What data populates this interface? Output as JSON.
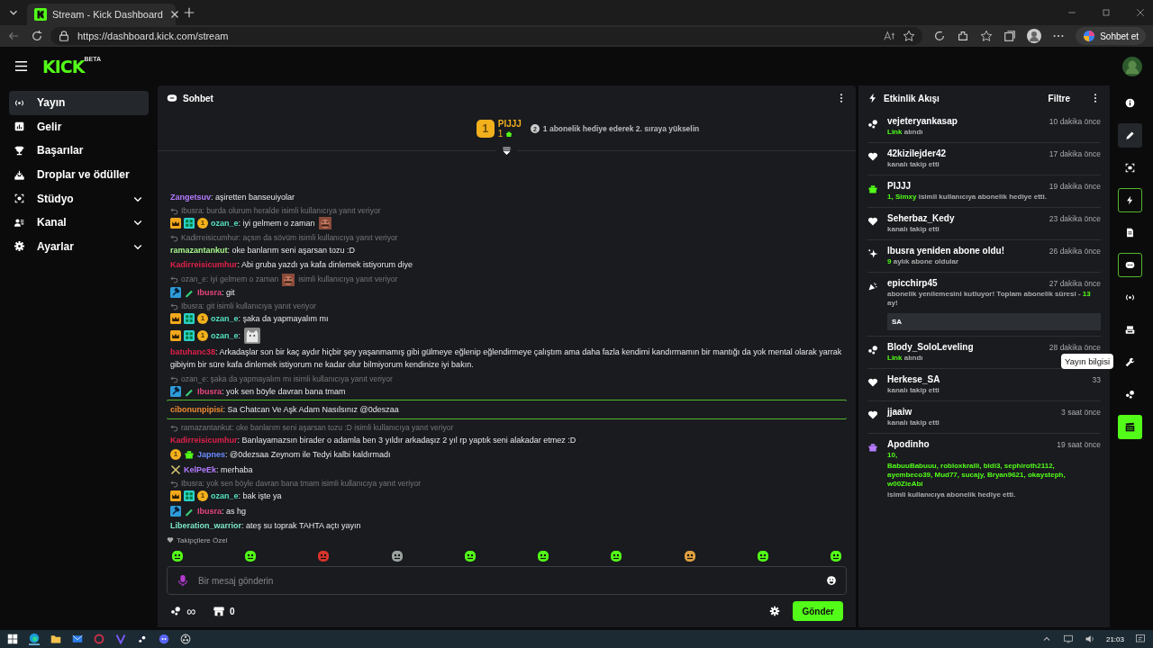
{
  "browser": {
    "tab_title": "Stream - Kick Dashboard",
    "url": "https://dashboard.kick.com/stream",
    "copilot_label": "Sohbet et"
  },
  "header": {
    "logo": "KICK",
    "logo_badge": "BETA"
  },
  "sidebar": {
    "items": [
      {
        "kind": "broadcast",
        "label": "Yayın",
        "selected": true,
        "expandable": false
      },
      {
        "kind": "chart",
        "label": "Gelir",
        "selected": false,
        "expandable": false
      },
      {
        "kind": "trophy",
        "label": "Başarılar",
        "selected": false,
        "expandable": false
      },
      {
        "kind": "drops",
        "label": "Droplar ve ödüller",
        "selected": false,
        "expandable": false
      },
      {
        "kind": "studio",
        "label": "Stüdyo",
        "selected": false,
        "expandable": true
      },
      {
        "kind": "channel",
        "label": "Kanal",
        "selected": false,
        "expandable": true
      },
      {
        "kind": "settings",
        "label": "Ayarlar",
        "selected": false,
        "expandable": true
      }
    ]
  },
  "chat": {
    "title": "Sohbet",
    "leaderboard": {
      "rank": "1",
      "name": "PIJJJ",
      "count": "1",
      "next_rank": "2",
      "hint": "1 abonelik hediye ederek 2. sıraya yükselin"
    },
    "messages": [
      {
        "user": "Zangetsuv",
        "color": "#b57bff",
        "text": ": aşiretten banseuiyolar",
        "highlighted": false
      },
      {
        "reply": "Ibusra: burda olurum heralde isimli kullanıcıya yanıt veriyor",
        "badges": [
          {
            "kind": "crown"
          },
          {
            "kind": "og"
          },
          {
            "kind": "tier",
            "label": "1"
          }
        ],
        "user": "ozan_e",
        "color": "#53e0c0",
        "text": ": iyi gelmem o zaman",
        "emote": {
          "kind": "face"
        },
        "highlighted": false
      },
      {
        "reply": "Kadirreisicumhur: açsın da sövüm isimli kullanıcıya yanıt veriyor",
        "user": "ramazantankut",
        "color": "#a6f58b",
        "text": ": oke banlarım seni aşarsan tozu :D",
        "highlighted": false
      },
      {
        "user": "Kadirreisicumhur",
        "color": "#e0204a",
        "text": ": Abi gruba yazdı ya kafa dinlemek istiyorum diye",
        "highlighted": false
      },
      {
        "reply": "ozan_e: iyi gelmem o zaman",
        "reply_emote": {
          "kind": "face"
        },
        "reply_suffix": "isimli kullanıcıya yanıt veriyor",
        "badges": [
          {
            "kind": "moderator"
          },
          {
            "kind": "pen"
          }
        ],
        "user": "Ibusra",
        "color": "#e8457a",
        "text": ": git",
        "highlighted": false
      },
      {
        "reply": "Ibusra: git isimli kullanıcıya yanıt veriyor",
        "badges": [
          {
            "kind": "crown"
          },
          {
            "kind": "og"
          },
          {
            "kind": "tier",
            "label": "1"
          }
        ],
        "user": "ozan_e",
        "color": "#53e0c0",
        "text": ": şaka da yapmayalım mı",
        "highlighted": false
      },
      {
        "badges": [
          {
            "kind": "crown"
          },
          {
            "kind": "og"
          },
          {
            "kind": "tier",
            "label": "1"
          }
        ],
        "user": "ozan_e",
        "color": "#53e0c0",
        "text": ":",
        "emote": {
          "kind": "cat"
        },
        "highlighted": false
      },
      {
        "user": "batuhanc38",
        "color": "#e0204a",
        "text": ": Arkadaşlar son bir kaç aydır hiçbir şey yaşanmamış gibi gülmeye eğlenip eğlendirmeye çalıştım ama daha fazla kendimi kandırmamın bir mantığı da yok mental olarak yarrak gibiyim bir süre kafa dinlemek istiyorum ne kadar olur bilmiyorum kendinize iyi bakın.",
        "highlighted": false
      },
      {
        "reply": "ozan_e: şaka da yapmayalım mı isimli kullanıcıya yanıt veriyor",
        "badges": [
          {
            "kind": "moderator"
          },
          {
            "kind": "pen"
          }
        ],
        "user": "Ibusra",
        "color": "#e8457a",
        "text": ": yok sen böyle davran bana tmam",
        "highlighted": false
      },
      {
        "user": "cibonunpipisi",
        "color": "#f08c30",
        "text": ": Sa Chatcan Ve Aşk Adam Nasılsınız @0deszaa",
        "highlighted": true
      },
      {
        "reply": "ramazantankut: oke banlarım seni aşarsan tozu :D isimli kullanıcıya yanıt veriyor",
        "user": "Kadirreisicumhur",
        "color": "#e0204a",
        "text": ": Banlayamazsın birader o adamla ben 3 yıldır arkadaşız 2 yıl rp yaptık seni alakadar etmez :D",
        "highlighted": false
      },
      {
        "badges": [
          {
            "kind": "tier",
            "label": "1"
          },
          {
            "kind": "gift"
          }
        ],
        "user": "Japnes",
        "color": "#6b8cff",
        "text": ": @0dezsaa Zeynom ile Tedyi kalbi kaldırmadı",
        "highlighted": false
      },
      {
        "badges": [
          {
            "kind": "swords"
          }
        ],
        "user": "KelPeEk",
        "color": "#b57bff",
        "text": ": merhaba",
        "highlighted": false
      },
      {
        "reply": "Ibusra: yok sen böyle davran bana tmam isimli kullanıcıya yanıt veriyor",
        "badges": [
          {
            "kind": "crown"
          },
          {
            "kind": "og"
          },
          {
            "kind": "tier",
            "label": "1"
          }
        ],
        "user": "ozan_e",
        "color": "#53e0c0",
        "text": ": bak işte ya",
        "highlighted": false
      },
      {
        "badges": [
          {
            "kind": "moderator"
          },
          {
            "kind": "pen"
          }
        ],
        "user": "Ibusra",
        "color": "#e8457a",
        "text": ": as hg",
        "highlighted": false
      },
      {
        "user": "Liberation_warrior",
        "color": "#7de8c8",
        "text": ": ateş su toprak TAHTA açtı yayın",
        "highlighted": false
      }
    ],
    "followers_label": "Takipçilere Özel",
    "quick_emotes": [
      {
        "color": "#53fc18"
      },
      {
        "color": "#53fc18"
      },
      {
        "color": "#d8342c"
      },
      {
        "color": "#9aa3a0"
      },
      {
        "color": "#53fc18"
      },
      {
        "color": "#53fc18"
      },
      {
        "color": "#53fc18"
      },
      {
        "color": "#e0a040"
      },
      {
        "color": "#53fc18"
      },
      {
        "color": "#53fc18"
      }
    ],
    "input": {
      "placeholder": "Bir mesaj gönderin"
    },
    "points": "∞",
    "store_count": "0",
    "send_label": "Gönder"
  },
  "feed": {
    "title": "Etkinlik Akışı",
    "filter_label": "Filtre",
    "items": [
      {
        "kind": "points",
        "color": "#ffffff",
        "user": "vejeteryankasap",
        "time": "10 dakika önce",
        "lines": [
          [
            {
              "text": "Link",
              "accent": true
            },
            {
              "text": " alındı",
              "accent": false
            }
          ]
        ]
      },
      {
        "kind": "follow",
        "color": "#ffffff",
        "user": "42kizilejder42",
        "time": "17 dakika önce",
        "lines": [
          [
            {
              "text": "kanalı takip etti",
              "accent": false
            }
          ]
        ]
      },
      {
        "kind": "gift",
        "color": "#53fc18",
        "user": "PIJJJ",
        "time": "19 dakika önce",
        "lines": [
          [
            {
              "text": "1, Simxy",
              "accent": true
            },
            {
              "text": " isimli kullanıcıya abonelik hediye etti.",
              "accent": false
            }
          ]
        ]
      },
      {
        "kind": "follow",
        "color": "#ffffff",
        "user": "Seherbaz_Kedy",
        "time": "23 dakika önce",
        "lines": [
          [
            {
              "text": "kanalı takip etti",
              "accent": false
            }
          ]
        ]
      },
      {
        "kind": "resub",
        "color": "#ffffff",
        "user": "Ibusra yeniden abone oldu!",
        "time": "26 dakika önce",
        "lines": [
          [
            {
              "text": "9",
              "accent": true
            },
            {
              "text": " aylık abone oldular",
              "accent": false
            }
          ]
        ]
      },
      {
        "kind": "celebrate",
        "color": "#ffffff",
        "user": "epicchirp45",
        "time": "27 dakika önce",
        "lines": [
          [
            {
              "text": "abonelik yenilemesini kutluyor! Toplam abonelik süresi - ",
              "accent": false
            },
            {
              "text": "13",
              "accent": true
            },
            {
              "text": " ay!",
              "accent": false
            }
          ]
        ],
        "message": "SA"
      },
      {
        "kind": "points",
        "color": "#ffffff",
        "user": "Blody_SoloLeveling",
        "time": "28 dakika önce",
        "lines": [
          [
            {
              "text": "Link",
              "accent": true
            },
            {
              "text": " alındı",
              "accent": false
            }
          ]
        ]
      },
      {
        "kind": "follow",
        "color": "#ffffff",
        "user": "Herkese_SA",
        "time": "33",
        "lines": [
          [
            {
              "text": "kanalı takip etti",
              "accent": false
            }
          ]
        ]
      },
      {
        "kind": "follow",
        "color": "#ffffff",
        "user": "jjaaiw",
        "time": "3 saat önce",
        "lines": [
          [
            {
              "text": "kanalı takip etti",
              "accent": false
            }
          ]
        ]
      },
      {
        "kind": "gift",
        "color": "#b57bff",
        "user": "Apodinho",
        "time": "19 saat önce",
        "lines": [
          [
            {
              "text": "10,",
              "accent": true
            }
          ],
          [
            {
              "text": "BabuuBabuuu, robloxkralli, bidi3, sephiroth2112, ayembeco39, Mud77, sucajy, Bryan9621, okaysteph, w00ZieAbi",
              "accent": true
            }
          ],
          [
            {
              "text": "isimli kullanıcıya abonelik hediye etti.",
              "accent": false
            }
          ]
        ]
      }
    ]
  },
  "rail": [
    {
      "kind": "info",
      "selected": false,
      "hovered": false
    },
    {
      "kind": "pencil",
      "selected": false,
      "hovered": true
    },
    {
      "kind": "screen",
      "selected": false,
      "hovered": false
    },
    {
      "kind": "bolt",
      "selected": true,
      "hovered": false
    },
    {
      "kind": "document",
      "selected": false,
      "hovered": false
    },
    {
      "kind": "chat",
      "selected": true,
      "hovered": false
    },
    {
      "kind": "broadcast",
      "selected": false,
      "hovered": false
    },
    {
      "kind": "camera",
      "selected": false,
      "hovered": false
    },
    {
      "kind": "wrench",
      "selected": false,
      "hovered": false,
      "tooltip": "Yayın bilgisi"
    },
    {
      "kind": "points",
      "selected": false,
      "hovered": false
    },
    {
      "kind": "clapper",
      "selected": false,
      "hovered": false
    }
  ],
  "taskbar": {
    "time": "21:03"
  }
}
